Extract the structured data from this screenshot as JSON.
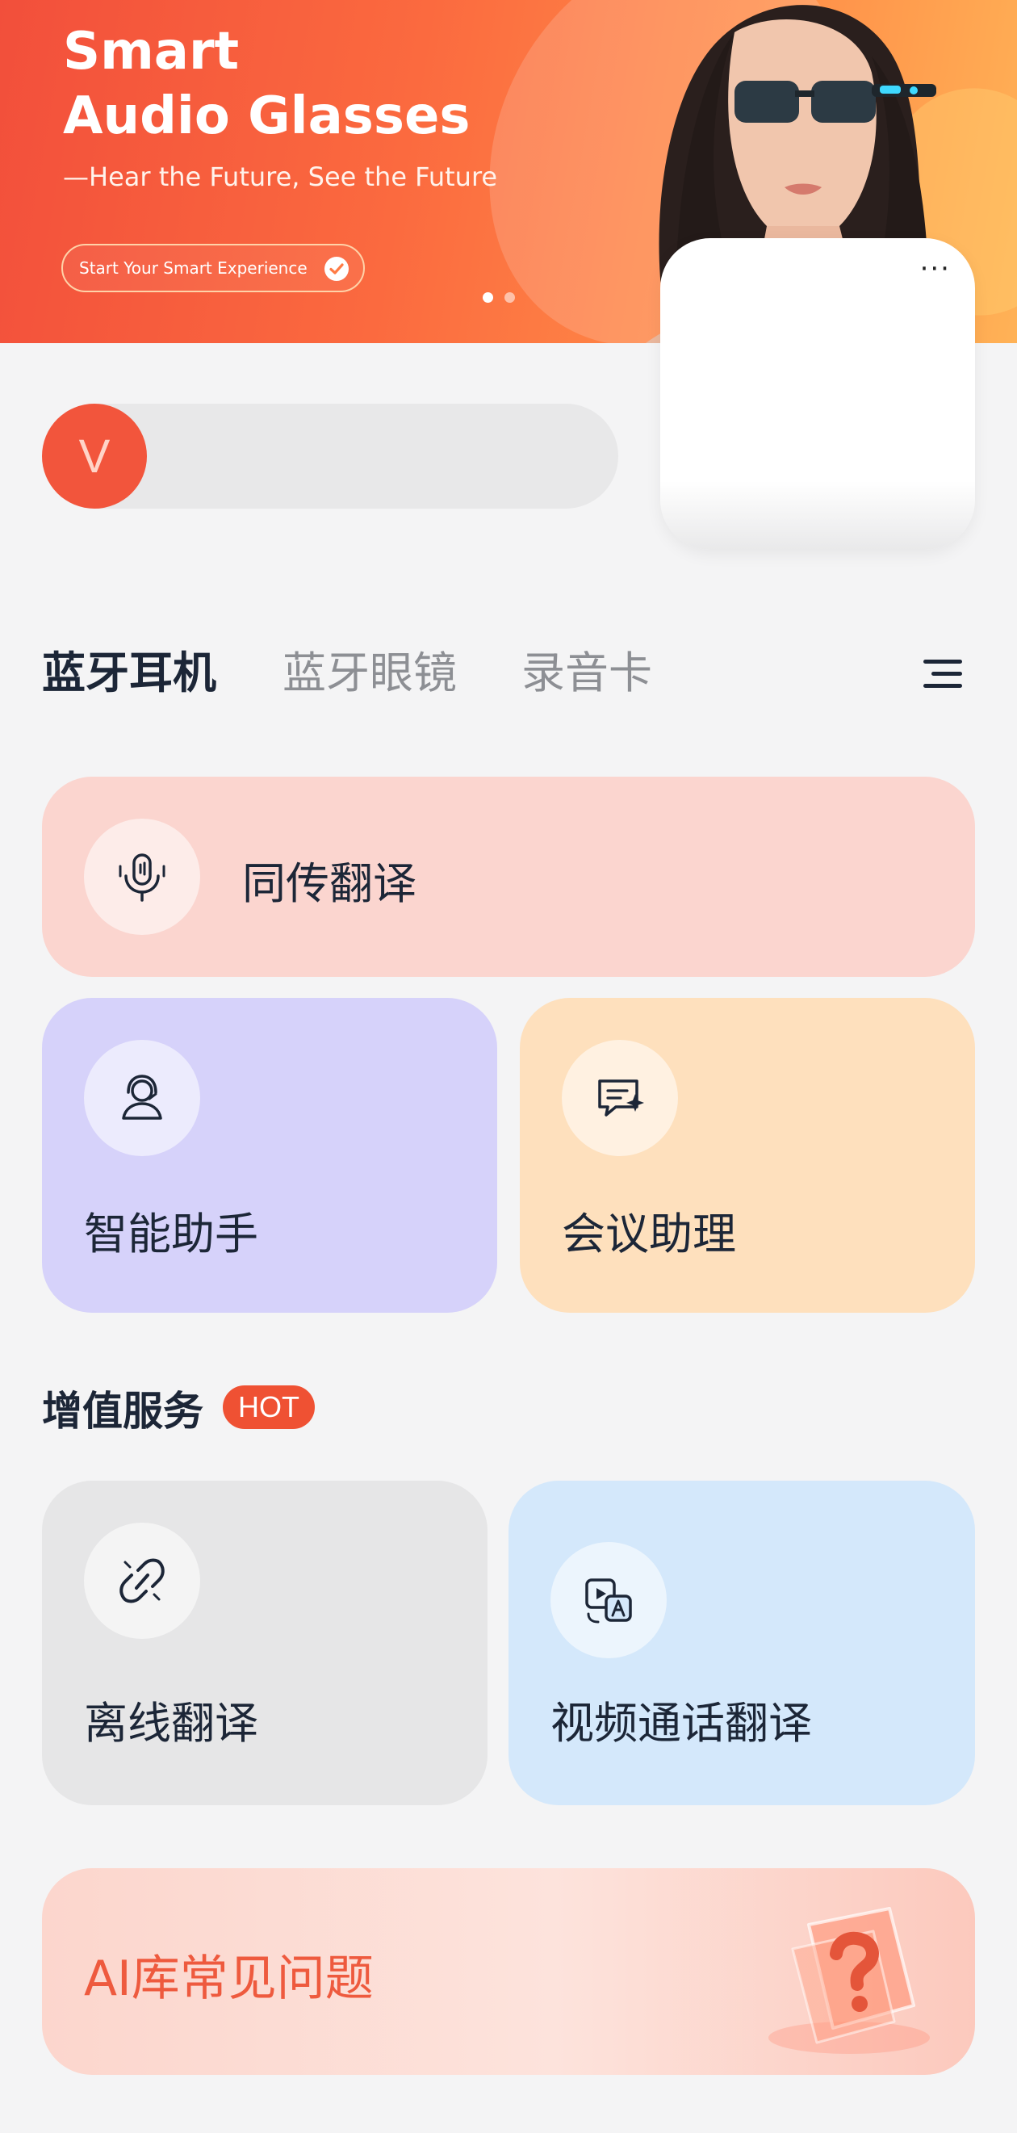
{
  "banner": {
    "title": "Smart\nAudio Glasses",
    "subtitle": "—Hear the Future, See the Future",
    "cta_label": "Start Your Smart Experience",
    "slide_count": 2,
    "active_slide": 1
  },
  "device": {
    "avatar_letter": "V"
  },
  "tabs": [
    {
      "label": "蓝牙耳机",
      "active": true
    },
    {
      "label": "蓝牙眼镜",
      "active": false
    },
    {
      "label": "录音卡",
      "active": false
    }
  ],
  "features": {
    "simultaneous_translation": "同传翻译",
    "smart_assistant": "智能助手",
    "meeting_assistant": "会议助理"
  },
  "value_added": {
    "title": "增值服务",
    "badge": "HOT",
    "offline_translation": "离线翻译",
    "video_call_translation": "视频通话翻译"
  },
  "faq": {
    "label": "AI库常见问题"
  },
  "colors": {
    "accent": "#EF5133",
    "translation_card": "#FBD5CF",
    "assistant_card": "#D6D2FA",
    "meeting_card": "#FEE0BD",
    "offline_card": "#E6E6E7",
    "video_card": "#D4E8FB"
  }
}
